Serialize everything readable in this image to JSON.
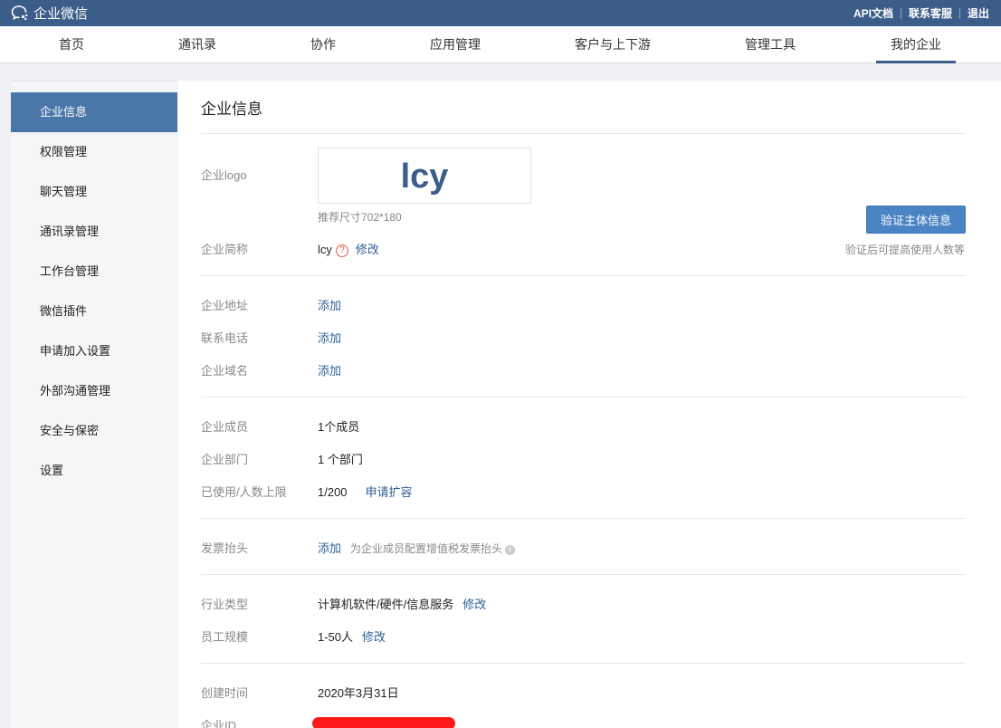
{
  "app": {
    "name": "企业微信"
  },
  "toplinks": [
    "API文档",
    "联系客服",
    "退出"
  ],
  "nav": [
    {
      "label": "首页"
    },
    {
      "label": "通讯录"
    },
    {
      "label": "协作"
    },
    {
      "label": "应用管理"
    },
    {
      "label": "客户与上下游"
    },
    {
      "label": "管理工具"
    },
    {
      "label": "我的企业",
      "active": true
    }
  ],
  "sidebar": [
    {
      "label": "企业信息",
      "active": true
    },
    {
      "label": "权限管理"
    },
    {
      "label": "聊天管理"
    },
    {
      "label": "通讯录管理"
    },
    {
      "label": "工作台管理"
    },
    {
      "label": "微信插件"
    },
    {
      "label": "申请加入设置"
    },
    {
      "label": "外部沟通管理"
    },
    {
      "label": "安全与保密"
    },
    {
      "label": "设置"
    }
  ],
  "main": {
    "title": "企业信息",
    "logo": {
      "label": "企业logo",
      "text": "lcy",
      "size_hint": "推荐尺寸702*180"
    },
    "verify": {
      "button": "验证主体信息",
      "hint": "验证后可提高使用人数等"
    },
    "short_name": {
      "label": "企业简称",
      "value": "lcy",
      "help": "?",
      "action": "修改"
    },
    "address": {
      "label": "企业地址",
      "action": "添加"
    },
    "phone": {
      "label": "联系电话",
      "action": "添加"
    },
    "domain": {
      "label": "企业域名",
      "action": "添加"
    },
    "members": {
      "label": "企业成员",
      "value": "1个成员"
    },
    "departments": {
      "label": "企业部门",
      "value": "1 个部门"
    },
    "usage": {
      "label": "已使用/人数上限",
      "value": "1/200",
      "action": "申请扩容"
    },
    "invoice": {
      "label": "发票抬头",
      "action": "添加",
      "hint": "为企业成员配置增值税发票抬头",
      "info": "i"
    },
    "industry": {
      "label": "行业类型",
      "value": "计算机软件/硬件/信息服务",
      "action": "修改"
    },
    "scale": {
      "label": "员工规模",
      "value": "1-50人",
      "action": "修改"
    },
    "created": {
      "label": "创建时间",
      "value": "2020年3月31日"
    },
    "corp_id": {
      "label": "企业ID"
    }
  },
  "colors": {
    "topbar": "#3b5d8a",
    "accent": "#4a76a8",
    "link": "#2e5f96",
    "button": "#4a84c4"
  },
  "icons": {
    "brand": "chat-bubble-icon",
    "help": "question-circle-icon",
    "info": "info-circle-icon"
  }
}
